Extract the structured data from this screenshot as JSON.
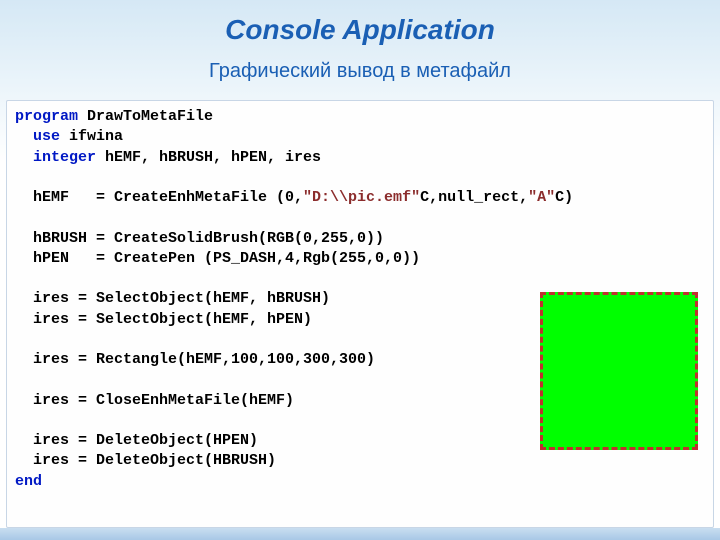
{
  "title": "Console Application",
  "subtitle": "Графический вывод в метафайл",
  "code": {
    "l1a": "program",
    "l1b": " DrawToMetaFile",
    "l2a": "  use",
    "l2b": " ifwina",
    "l3a": "  integer",
    "l3b": " hEMF, hBRUSH, hPEN, ires",
    "l4": "",
    "l5a": "  hEMF   = CreateEnhMetaFile (0,",
    "l5b": "\"D:\\\\pic.emf\"",
    "l5c": "C,null_rect,",
    "l5d": "\"A\"",
    "l5e": "C)",
    "l6": "",
    "l7": "  hBRUSH = CreateSolidBrush(RGB(0,255,0))",
    "l8": "  hPEN   = CreatePen (PS_DASH,4,Rgb(255,0,0))",
    "l9": "",
    "l10": "  ires = SelectObject(hEMF, hBRUSH)",
    "l11": "  ires = SelectObject(hEMF, hPEN)",
    "l12": "",
    "l13": "  ires = Rectangle(hEMF,100,100,300,300)",
    "l14": "",
    "l15": "  ires = CloseEnhMetaFile(hEMF)",
    "l16": "",
    "l17": "  ires = DeleteObject(HPEN)",
    "l18": "  ires = DeleteObject(HBRUSH)",
    "l19": "end"
  }
}
